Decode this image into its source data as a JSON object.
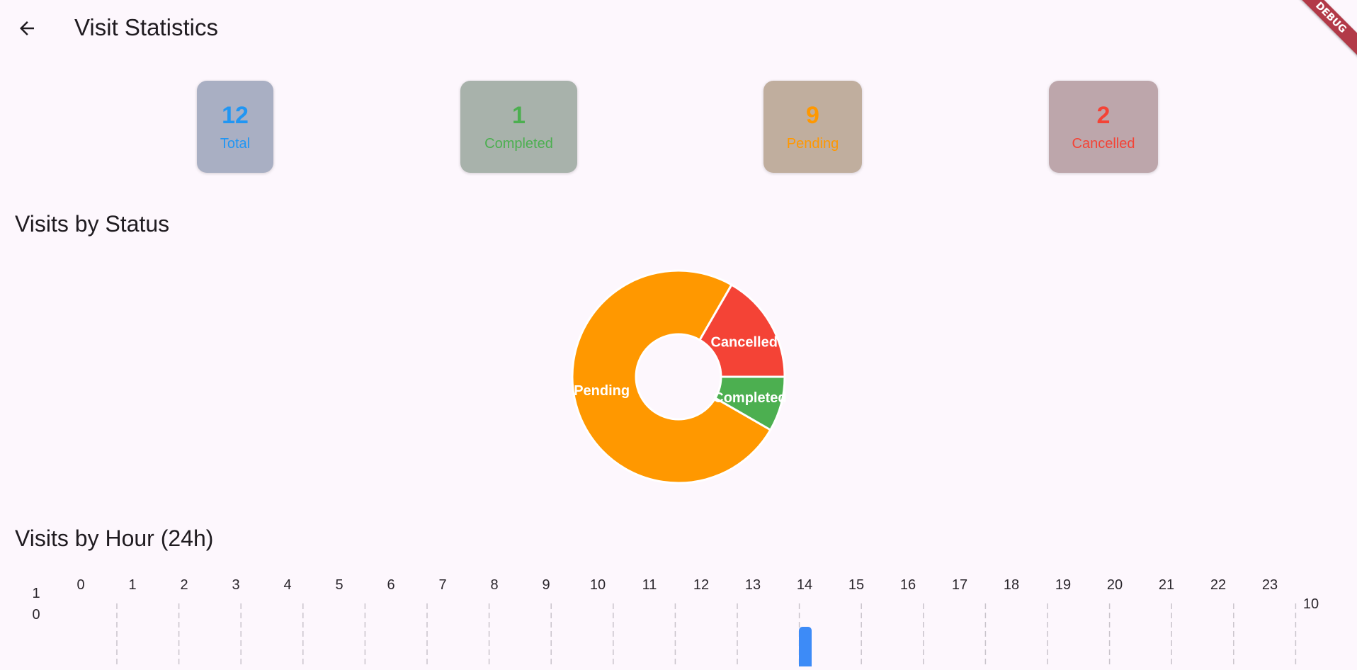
{
  "app_bar": {
    "title": "Visit Statistics",
    "back_icon": "arrow-left-icon"
  },
  "debug_banner": "DEBUG",
  "stats": [
    {
      "value": "12",
      "label": "Total",
      "color": "#2196f3",
      "bg": "#a9afc3"
    },
    {
      "value": "1",
      "label": "Completed",
      "color": "#4caf50",
      "bg": "#a8b2ab"
    },
    {
      "value": "9",
      "label": "Pending",
      "color": "#ff9800",
      "bg": "#c0ae9e"
    },
    {
      "value": "2",
      "label": "Cancelled",
      "color": "#f44336",
      "bg": "#bda6ab"
    }
  ],
  "sections": {
    "status_title": "Visits by Status",
    "hour_title": "Visits by Hour (24h)"
  },
  "chart_data": [
    {
      "type": "pie",
      "title": "Visits by Status",
      "donut": true,
      "slices": [
        {
          "label": "Pending",
          "value": 9,
          "color": "#ff9800"
        },
        {
          "label": "Cancelled",
          "value": 2,
          "color": "#f44336"
        },
        {
          "label": "Completed",
          "value": 1,
          "color": "#4caf50"
        }
      ]
    },
    {
      "type": "bar",
      "title": "Visits by Hour (24h)",
      "categories": [
        "0",
        "1",
        "2",
        "3",
        "4",
        "5",
        "6",
        "7",
        "8",
        "9",
        "10",
        "11",
        "12",
        "13",
        "14",
        "15",
        "16",
        "17",
        "18",
        "19",
        "20",
        "21",
        "22",
        "23"
      ],
      "values": [
        0,
        0,
        0,
        0,
        0,
        0,
        0,
        0,
        0,
        0,
        0,
        0,
        0,
        0,
        10,
        0,
        0,
        0,
        0,
        0,
        0,
        0,
        0,
        0
      ],
      "left_axis_label_lines": [
        "1",
        "0"
      ],
      "right_axis_label": "10",
      "bar_color": "#3d8bf7",
      "grid": "vertical-dashed"
    }
  ]
}
